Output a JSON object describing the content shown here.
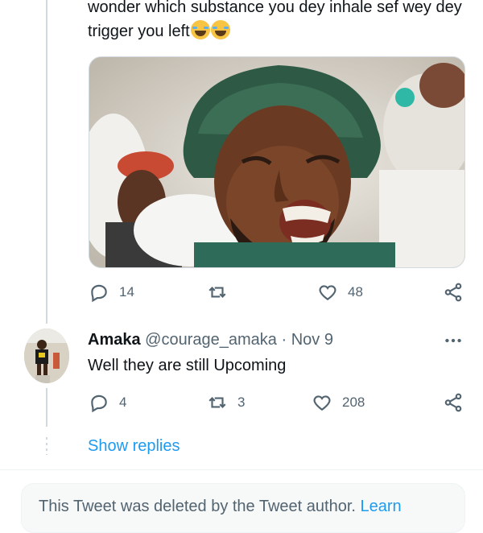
{
  "tweet": {
    "text": "wonder which substance you dey inhale sef wey dey trigger you left",
    "emojis": [
      "face-with-tears-of-joy",
      "face-with-tears-of-joy"
    ],
    "media_icon": "photo-crying-man-in-green-bucket-hat",
    "actions": {
      "replies": "14",
      "retweets": "",
      "likes": "48"
    }
  },
  "reply": {
    "name": "Amaka",
    "handle": "@courage_amaka",
    "separator": "·",
    "date": "Nov 9",
    "text": "Well they are still Upcoming",
    "actions": {
      "replies": "4",
      "retweets": "3",
      "likes": "208"
    }
  },
  "show_replies": "Show replies",
  "deleted_notice": {
    "text": "This Tweet was deleted by the Tweet author.",
    "link": "Learn"
  },
  "colors": {
    "text": "#0f1419",
    "muted": "#536471",
    "link": "#1d9bf0",
    "line": "#cfd9de"
  }
}
